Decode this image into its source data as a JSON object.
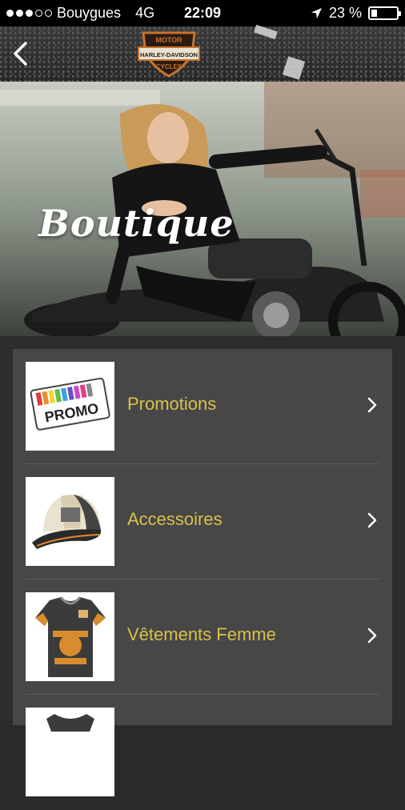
{
  "status_bar": {
    "carrier": "Bouygues",
    "network": "4G",
    "time": "22:09",
    "battery": "23 %",
    "battery_level": 0.23
  },
  "nav": {
    "back_icon": "chevron-left-icon",
    "logo_text_top": "MOTOR",
    "logo_text_mid": "HARLEY-DAVIDSON",
    "logo_text_bottom": "CYCLES"
  },
  "hero": {
    "title": "Boutique"
  },
  "list": {
    "items": [
      {
        "label": "Promotions",
        "thumb_text": "PROMO"
      },
      {
        "label": "Accessoires",
        "thumb_text": ""
      },
      {
        "label": "Vêtements Femme",
        "thumb_text": ""
      },
      {
        "label": "",
        "thumb_text": ""
      }
    ]
  },
  "colors": {
    "accent_label": "#d8c24a",
    "list_background": "#474747",
    "page_background": "#2d2d2d"
  }
}
